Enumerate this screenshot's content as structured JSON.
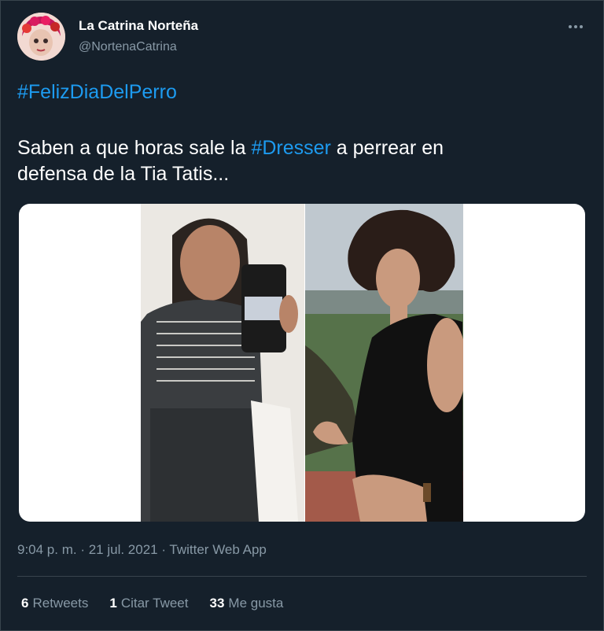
{
  "author": {
    "name": "La Catrina Norteña",
    "handle": "@NortenaCatrina"
  },
  "tweet": {
    "hashtag_line": "#FelizDiaDelPerro",
    "text_part1": "Saben a que horas sale la ",
    "text_hashtag": "#Dresser",
    "text_part2": " a perrear en",
    "text_line2": "defensa de la Tia Tatis..."
  },
  "meta": {
    "timestamp": "9:04 p. m. · 21 jul. 2021 · Twitter Web App"
  },
  "stats": {
    "retweets_count": "6",
    "retweets_label": "Retweets",
    "quote_count": "1",
    "quote_label": "Citar Tweet",
    "likes_count": "33",
    "likes_label": "Me gusta"
  },
  "colors": {
    "background": "#15202b",
    "link": "#1d9bf0",
    "secondary_text": "#8899a6",
    "divider": "#38444d"
  },
  "icons": {
    "more": "more-horizontal-icon"
  }
}
